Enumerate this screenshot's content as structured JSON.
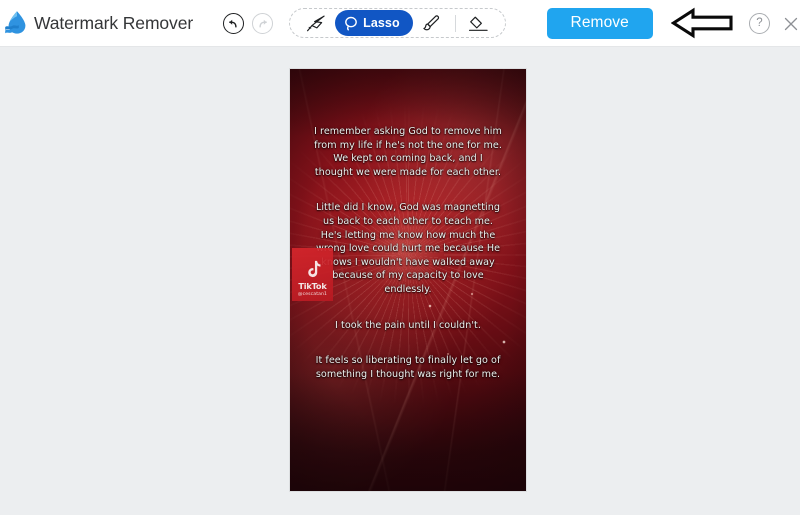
{
  "app": {
    "title": "Watermark Remover",
    "logo_icon": "water-drop-icon",
    "accent_primary": "#20a5ef",
    "accent_tool_active": "#1156c4",
    "canvas_background": "#eceef0"
  },
  "header": {
    "history": {
      "undo_label": "Undo",
      "undo_icon": "undo-arrow-icon",
      "undo_enabled": "true",
      "redo_label": "Redo",
      "redo_icon": "redo-arrow-icon",
      "redo_enabled": "false"
    },
    "tools": [
      {
        "id": "magic-wand",
        "label": "Magic Wand",
        "icon": "magic-wand-icon",
        "selected": "false",
        "show_label": "false"
      },
      {
        "id": "lasso",
        "label": "Lasso",
        "icon": "lasso-icon",
        "selected": "true",
        "show_label": "true"
      },
      {
        "id": "brush",
        "label": "Brush",
        "icon": "brush-icon",
        "selected": "false",
        "show_label": "false"
      },
      {
        "id": "eraser",
        "label": "Eraser",
        "icon": "eraser-icon",
        "selected": "false",
        "show_label": "false"
      }
    ],
    "remove_button": {
      "label": "Remove",
      "color": "#20a5ef"
    },
    "annotation": {
      "type": "left-arrow",
      "description": "Black outlined arrow pointing left toward the Remove button"
    },
    "help": {
      "label": "?",
      "icon": "help-circle-icon"
    },
    "close": {
      "label": "",
      "icon": "close-x-icon"
    }
  },
  "canvas": {
    "media": {
      "kind": "video-frame",
      "orientation": "portrait",
      "background_description": "Dark red fireworks burst backdrop",
      "captions": [
        "I remember asking God to remove him from my life if he's not the one for me. We kept on coming back, and I thought we were made for each other.",
        "Little did I know, God was magnetting us back to each other to teach me. He's letting me know how much the wrong love could hurt me because He knows I wouldn't have walked away because of my capacity to love endlessly.",
        "I took the pain until I couldn't.",
        "It feels so liberating to finally let go of something I thought was right for me."
      ],
      "watermark": {
        "platform": "TikTok",
        "wordmark": "TikTok",
        "handle": "@cescatan1",
        "icon": "tiktok-note-icon"
      }
    }
  }
}
